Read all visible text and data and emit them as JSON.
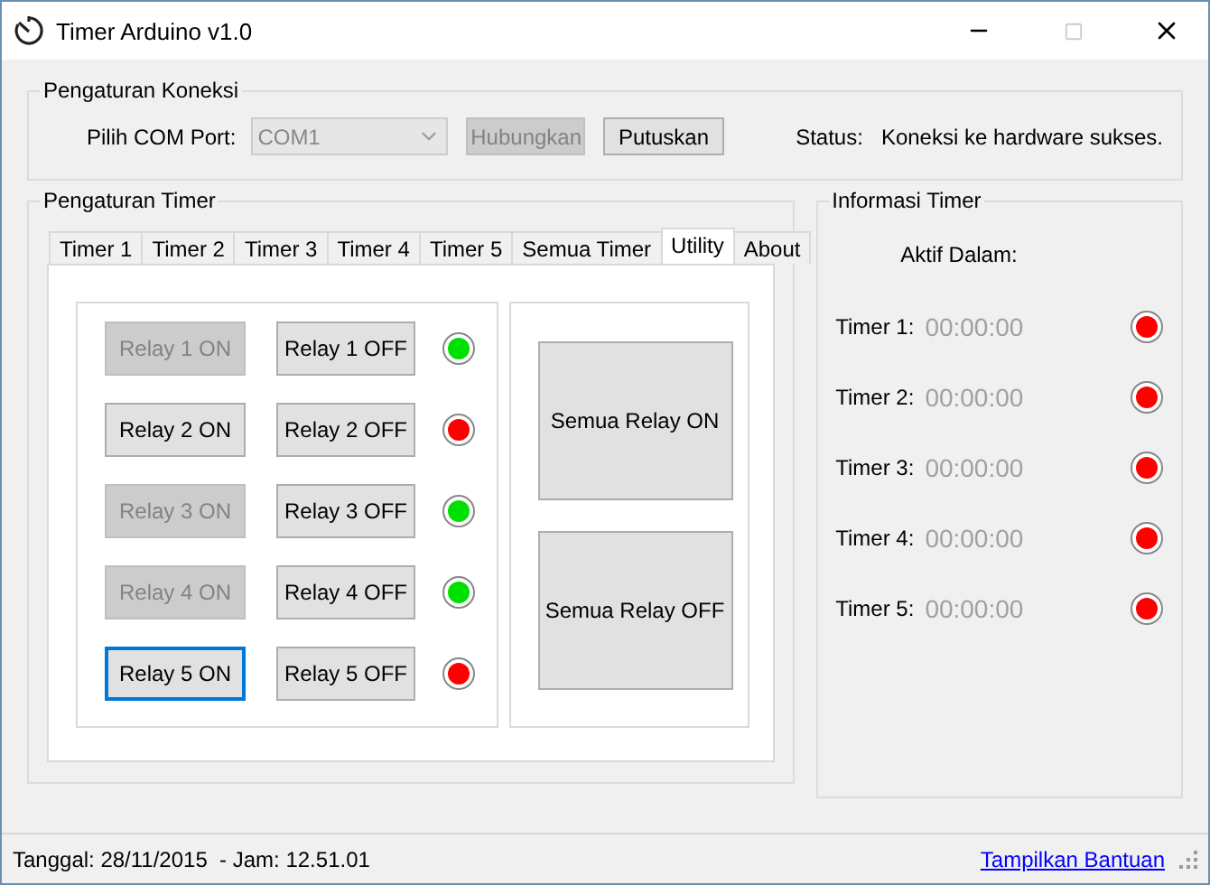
{
  "window": {
    "title": "Timer Arduino v1.0"
  },
  "connection": {
    "title": "Pengaturan Koneksi",
    "port_label": "Pilih COM Port:",
    "port": {
      "value": "COM1",
      "disabled": true
    },
    "buttons": [
      {
        "label": "Hubungkan",
        "disabled": true
      },
      {
        "label": "Putuskan",
        "disabled": false
      }
    ],
    "status_label": "Status:",
    "status": "Koneksi ke hardware sukses."
  },
  "timer_settings": {
    "title": "Pengaturan Timer",
    "tabs": [
      {
        "label": "Timer 1",
        "selected": false
      },
      {
        "label": "Timer 2",
        "selected": false
      },
      {
        "label": "Timer 3",
        "selected": false
      },
      {
        "label": "Timer 4",
        "selected": false
      },
      {
        "label": "Timer 5",
        "selected": false
      },
      {
        "label": "Semua Timer",
        "selected": false
      },
      {
        "label": "Utility",
        "selected": true
      },
      {
        "label": "About",
        "selected": false
      }
    ],
    "relays": [
      {
        "on_label": "Relay 1 ON",
        "on_disabled": true,
        "on_focused": false,
        "off_label": "Relay 1 OFF",
        "color": "#00e000"
      },
      {
        "on_label": "Relay 2 ON",
        "on_disabled": false,
        "on_focused": false,
        "off_label": "Relay 2 OFF",
        "color": "#ff0000"
      },
      {
        "on_label": "Relay 3 ON",
        "on_disabled": true,
        "on_focused": false,
        "off_label": "Relay 3 OFF",
        "color": "#00e000"
      },
      {
        "on_label": "Relay 4 ON",
        "on_disabled": true,
        "on_focused": false,
        "off_label": "Relay 4 OFF",
        "color": "#00e000"
      },
      {
        "on_label": "Relay 5 ON",
        "on_disabled": false,
        "on_focused": true,
        "off_label": "Relay 5 OFF",
        "color": "#ff0000"
      }
    ],
    "all_buttons": [
      "Semua Relay ON",
      "Semua Relay OFF"
    ]
  },
  "timer_info": {
    "title": "Informasi Timer",
    "heading": "Aktif Dalam:",
    "timers": [
      {
        "label": "Timer 1:",
        "time": "00:00:00",
        "color": "#ff0000"
      },
      {
        "label": "Timer 2:",
        "time": "00:00:00",
        "color": "#ff0000"
      },
      {
        "label": "Timer 3:",
        "time": "00:00:00",
        "color": "#ff0000"
      },
      {
        "label": "Timer 4:",
        "time": "00:00:00",
        "color": "#ff0000"
      },
      {
        "label": "Timer 5:",
        "time": "00:00:00",
        "color": "#ff0000"
      }
    ]
  },
  "status_bar": {
    "date": "Tanggal: 28/11/2015  - Jam: 12.51.01",
    "help_link": "Tampilkan Bantuan"
  }
}
